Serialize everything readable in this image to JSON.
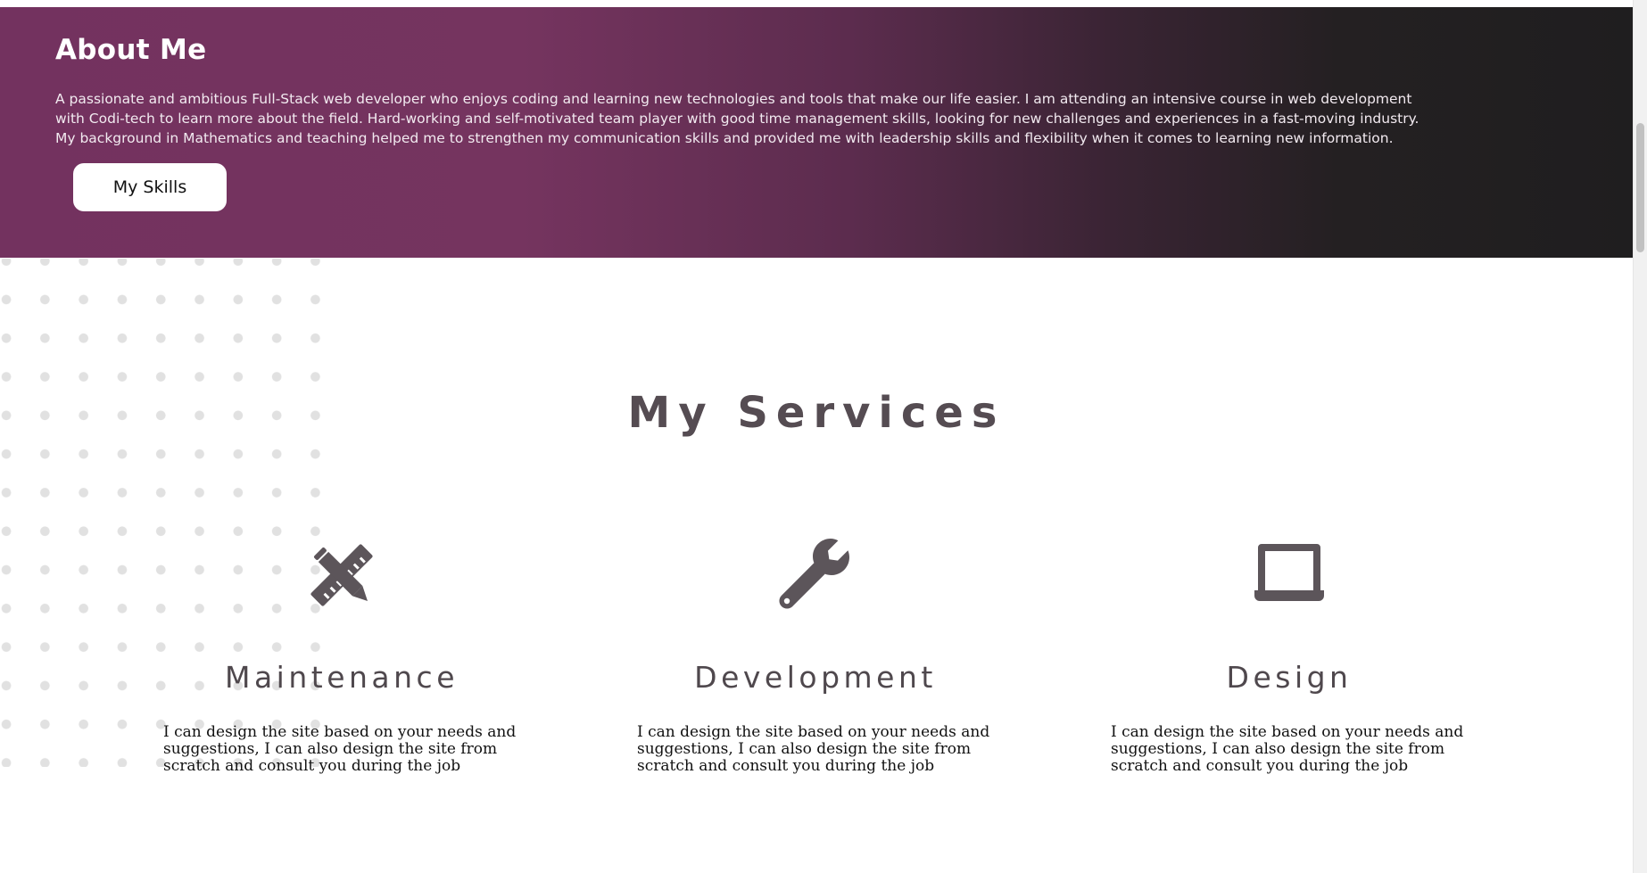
{
  "about": {
    "title": "About Me",
    "body": "A passionate and ambitious Full-Stack web developer who enjoys coding and learning new technologies and tools that make our life easier. I am attending an intensive course in web development with Codi-tech to learn more about the field. Hard-working and self-motivated team player with good time management skills, looking for new challenges and experiences in a fast-moving industry. My background in Mathematics and teaching helped me to strengthen my communication skills and provided me with leadership skills and flexibility when it comes to learning new information.",
    "button_label": "My Skills"
  },
  "services": {
    "title": "My Services",
    "items": [
      {
        "icon": "ruler-pencil-icon",
        "title": "Maintenance",
        "description": "I can design the site based on your needs and suggestions, I can also design the site from scratch and consult you during the job"
      },
      {
        "icon": "wrench-icon",
        "title": "Development",
        "description": "I can design the site based on your needs and suggestions, I can also design the site from scratch and consult you during the job"
      },
      {
        "icon": "laptop-icon",
        "title": "Design",
        "description": "I can design the site based on your needs and suggestions, I can also design the site from scratch and consult you during the job"
      }
    ]
  },
  "colors": {
    "accent_purple": "#75345f",
    "dark": "#1f1e1f",
    "heading_gray": "#554c52",
    "icon_gray": "#5c555a",
    "dot_gray": "#e1e1e1"
  }
}
